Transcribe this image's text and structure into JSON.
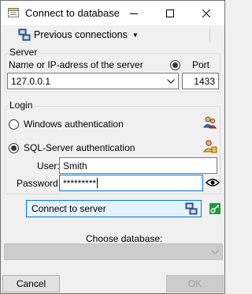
{
  "window": {
    "title": "Connect to database"
  },
  "toolbar": {
    "previous_connections_label": "Previous connections"
  },
  "server": {
    "group_label": "Server",
    "name_label": "Name or IP-adress of the server",
    "port_label": "Port",
    "server_value": "127.0.0.1",
    "port_value": "1433"
  },
  "login": {
    "group_label": "Login",
    "windows_auth_label": "Windows authentication",
    "sql_auth_label": "SQL-Server authentication",
    "user_label": "User:",
    "user_value": "Smith",
    "password_label": "Password:",
    "password_value": "*********"
  },
  "actions": {
    "connect_label": "Connect to server",
    "choose_db_label": "Choose database:",
    "cancel_label": "Cancel",
    "ok_label": "OK"
  },
  "colors": {
    "accent": "#0078d7",
    "connect_icon_green": "#1e9a3c"
  }
}
